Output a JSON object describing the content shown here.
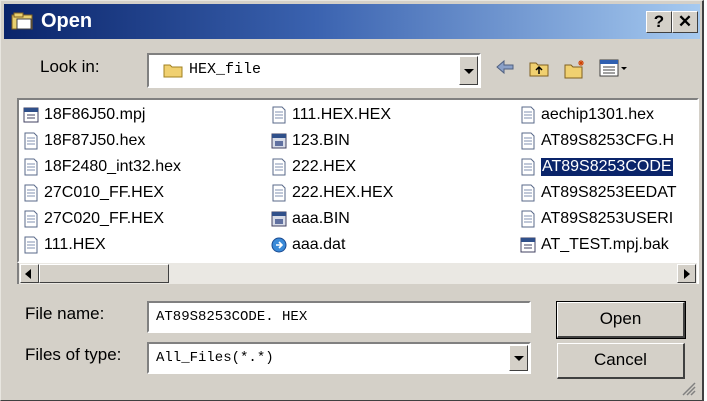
{
  "window": {
    "title": "Open",
    "help_label": "?",
    "close_label": "✕"
  },
  "look_in": {
    "label": "Look in:",
    "value": "HEX_file"
  },
  "toolbar": {
    "icons": [
      "back-icon",
      "up-folder-icon",
      "new-folder-icon",
      "view-menu-icon"
    ]
  },
  "files": [
    {
      "name": "18F86J50.mpj",
      "icon": "project-file-icon"
    },
    {
      "name": "18F87J50.hex",
      "icon": "document-icon"
    },
    {
      "name": "18F2480_int32.hex",
      "icon": "document-icon"
    },
    {
      "name": "27C010_FF.HEX",
      "icon": "document-icon"
    },
    {
      "name": "27C020_FF.HEX",
      "icon": "document-icon"
    },
    {
      "name": "111.HEX",
      "icon": "document-icon"
    },
    {
      "name": "111.HEX.HEX",
      "icon": "document-icon"
    },
    {
      "name": "123.BIN",
      "icon": "binary-file-icon"
    },
    {
      "name": "222.HEX",
      "icon": "document-icon"
    },
    {
      "name": "222.HEX.HEX",
      "icon": "document-icon"
    },
    {
      "name": "aaa.BIN",
      "icon": "binary-file-icon"
    },
    {
      "name": "aaa.dat",
      "icon": "dat-file-icon"
    },
    {
      "name": "aechip1301.hex",
      "icon": "document-icon"
    },
    {
      "name": "AT89S8253CFG.H",
      "icon": "document-icon"
    },
    {
      "name": "AT89S8253CODE",
      "icon": "document-icon",
      "selected": true
    },
    {
      "name": "AT89S8253EEDAT",
      "icon": "document-icon"
    },
    {
      "name": "AT89S8253USERI",
      "icon": "document-icon"
    },
    {
      "name": "AT_TEST.mpj.bak",
      "icon": "project-file-icon"
    }
  ],
  "file_name": {
    "label": "File name:",
    "value": "AT89S8253CODE. HEX"
  },
  "file_type": {
    "label": "Files of type:",
    "value": "All_Files(*.*)"
  },
  "buttons": {
    "open": "Open",
    "cancel": "Cancel"
  },
  "colors": {
    "title_gradient_start": "#0a246a",
    "title_gradient_end": "#a6caf0",
    "selection": "#0a246a",
    "dialog_face": "#d4d0c8"
  }
}
